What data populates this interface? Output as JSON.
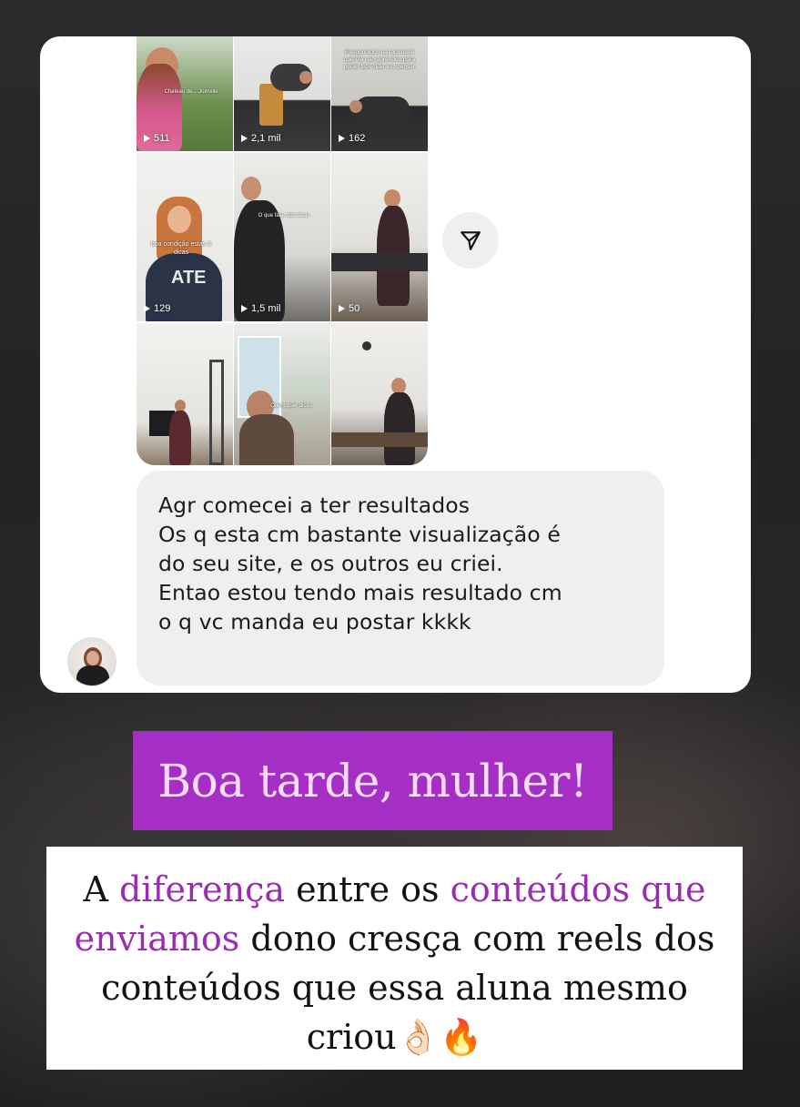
{
  "grid": {
    "tiles": [
      {
        "views": "511",
        "overlay": "Chateau de... Joinville"
      },
      {
        "views": "2,1 mil",
        "overlay": ""
      },
      {
        "views": "162",
        "overlay": "Respondidos na facilidade que ela nao aprendeu para poder faze dias vez pensar"
      },
      {
        "views": "129",
        "overlay": "boa condição estas 3 dicas"
      },
      {
        "views": "1,5 mil",
        "overlay": "O que falar das dicas"
      },
      {
        "views": "50",
        "overlay": ""
      },
      {
        "views": "",
        "overlay": ""
      },
      {
        "views": "",
        "overlay": "Quem quer dicas"
      },
      {
        "views": "",
        "overlay": ""
      }
    ]
  },
  "share_icon": "send-icon",
  "message": {
    "lines": [
      "Agr comecei a ter resultados",
      "Os q esta cm bastante visualização é",
      "do seu site, e os outros eu criei.",
      "Entao estou tendo mais resultado cm",
      "o q vc manda eu postar kkkk"
    ]
  },
  "heading": "Boa tarde, mulher!",
  "caption": {
    "p1": "A ",
    "hl1": "diferença",
    "p2": " entre os ",
    "hl2": "conteúdos que enviamos",
    "p3": " dono cresça com reels dos conteúdos que essa aluna mesmo criou",
    "emojis": "👌🏻🔥"
  },
  "colors": {
    "heading_bg": "#a52fc4",
    "heading_text": "#f6dcf5",
    "highlight": "#9c2bb3"
  }
}
